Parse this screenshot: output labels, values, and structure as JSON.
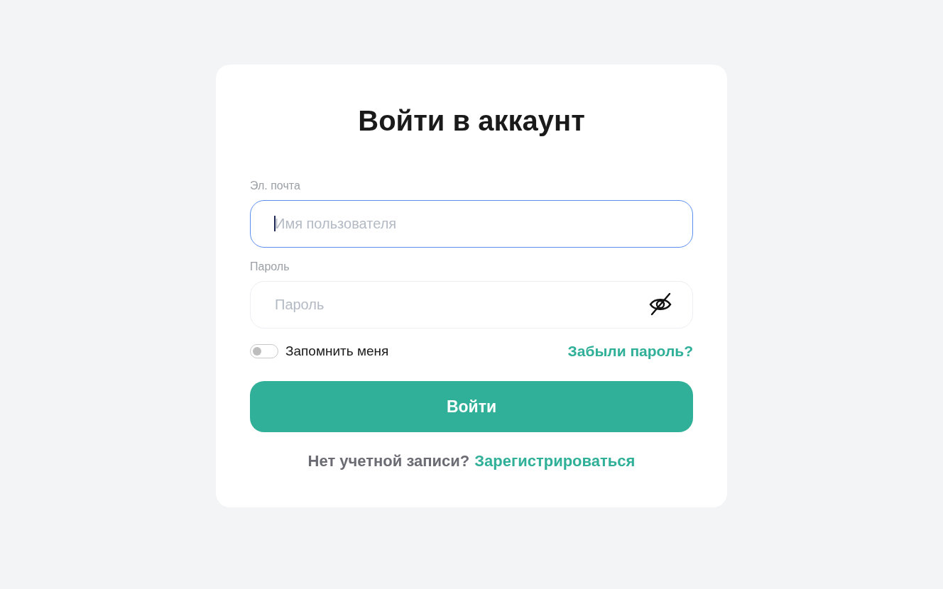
{
  "title": "Войти в аккаунт",
  "fields": [
    {
      "kind": "text",
      "label": "Эл. почта",
      "placeholder": "Имя пользователя",
      "focused": true
    },
    {
      "kind": "password",
      "label": "Пароль",
      "placeholder": "Пароль",
      "focused": false
    }
  ],
  "remember": {
    "label": "Запомнить меня",
    "on": false
  },
  "forgot_link": "Забыли пароль?",
  "submit": "Войти",
  "footer": {
    "text": "Нет учетной записи?",
    "link": "Зарегистрироваться"
  }
}
